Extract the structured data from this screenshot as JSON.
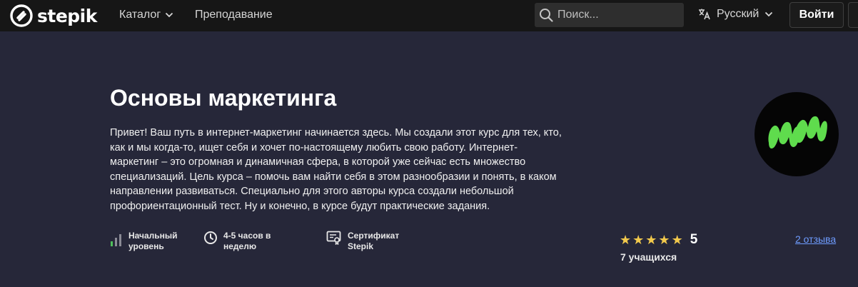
{
  "header": {
    "logo_text": "stepik",
    "nav": {
      "catalog": "Каталог",
      "teaching": "Преподавание"
    },
    "search": {
      "placeholder": "Поиск...",
      "value": ""
    },
    "language": "Русский",
    "login": "Войти"
  },
  "course": {
    "title": "Основы маркетинга",
    "description_lines": [
      "Привет! Ваш путь в интернет-маркетинг начинается здесь. Мы создали этот курс для тех, кто,",
      "как и мы когда-то, ищет себя и хочет по-настоящему любить свою работу. Интернет-",
      "маркетинг – это огромная и динамичная сфера, в которой уже сейчас есть множество",
      "специализаций. Цель курса – помочь вам найти себя в этом разнообразии и понять, в каком",
      "направлении развиваться. Специально для этого авторы курса создали небольшой",
      "профориентационный тест. Ну и конечно, в курсе будут практические задания."
    ],
    "features": {
      "level": [
        "Начальный",
        "уровень"
      ],
      "time": [
        "4-5 часов в",
        "неделю"
      ],
      "certificate": [
        "Сертификат",
        "Stepik"
      ]
    },
    "rating": {
      "stars": 5,
      "value": "5"
    },
    "learners": "7 учащихся",
    "reviews": "2 отзыва"
  },
  "colors": {
    "page_bg": "#262739",
    "header_bg": "#161616",
    "star": "#f2c94c",
    "link": "#6e9cff",
    "level_bar_active": "#4fbf5b",
    "logo_green": "#5fdc4d"
  }
}
